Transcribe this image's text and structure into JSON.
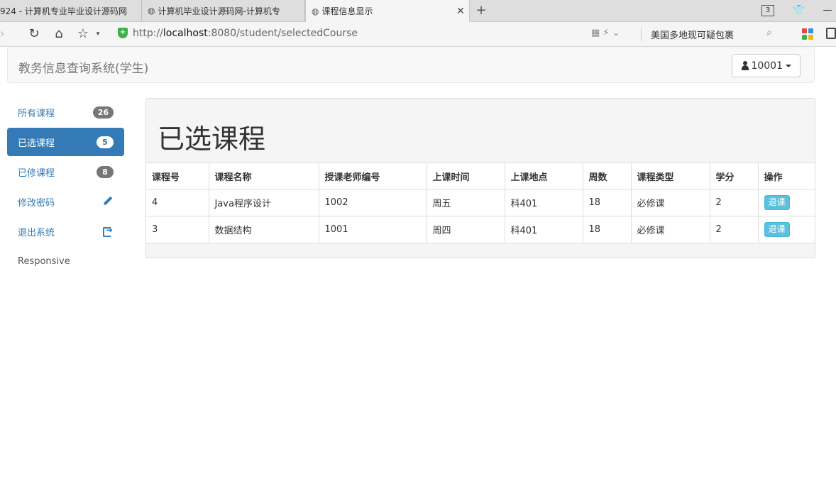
{
  "browser": {
    "tabs": [
      {
        "title": "924 - 计算机专业毕业设计源码网",
        "active": false
      },
      {
        "title": "计算机毕业设计源码网-计算机专",
        "active": false
      },
      {
        "title": "课程信息显示",
        "active": true
      }
    ],
    "tab_count": "3",
    "url_prefix": "http://",
    "url_host": "localhost",
    "url_rest": ":8080/student/selectedCourse",
    "hot_search": "美国多地现可疑包裹"
  },
  "navbar": {
    "brand": "教务信息查询系统(学生)",
    "user": "10001"
  },
  "sidebar": {
    "items": [
      {
        "label": "所有课程",
        "badge": "26"
      },
      {
        "label": "已选课程",
        "badge": "5"
      },
      {
        "label": "已修课程",
        "badge": "8"
      },
      {
        "label": "修改密码",
        "icon": "pencil-icon"
      },
      {
        "label": "退出系统",
        "icon": "logout-icon"
      },
      {
        "label": "Responsive"
      }
    ]
  },
  "panel": {
    "title": "已选课程",
    "columns": [
      "课程号",
      "课程名称",
      "授课老师编号",
      "上课时间",
      "上课地点",
      "周数",
      "课程类型",
      "学分",
      "操作"
    ],
    "rows": [
      {
        "id": "4",
        "name": "Java程序设计",
        "teacher": "1002",
        "time": "周五",
        "place": "科401",
        "weeks": "18",
        "type": "必修课",
        "credit": "2",
        "action": "退课"
      },
      {
        "id": "3",
        "name": "数据结构",
        "teacher": "1001",
        "time": "周四",
        "place": "科401",
        "weeks": "18",
        "type": "必修课",
        "credit": "2",
        "action": "退课"
      }
    ]
  },
  "colors": {
    "primary": "#337ab7",
    "info_button": "#5bc0de",
    "badge": "#777777",
    "shield_green": "#3cb34a"
  }
}
